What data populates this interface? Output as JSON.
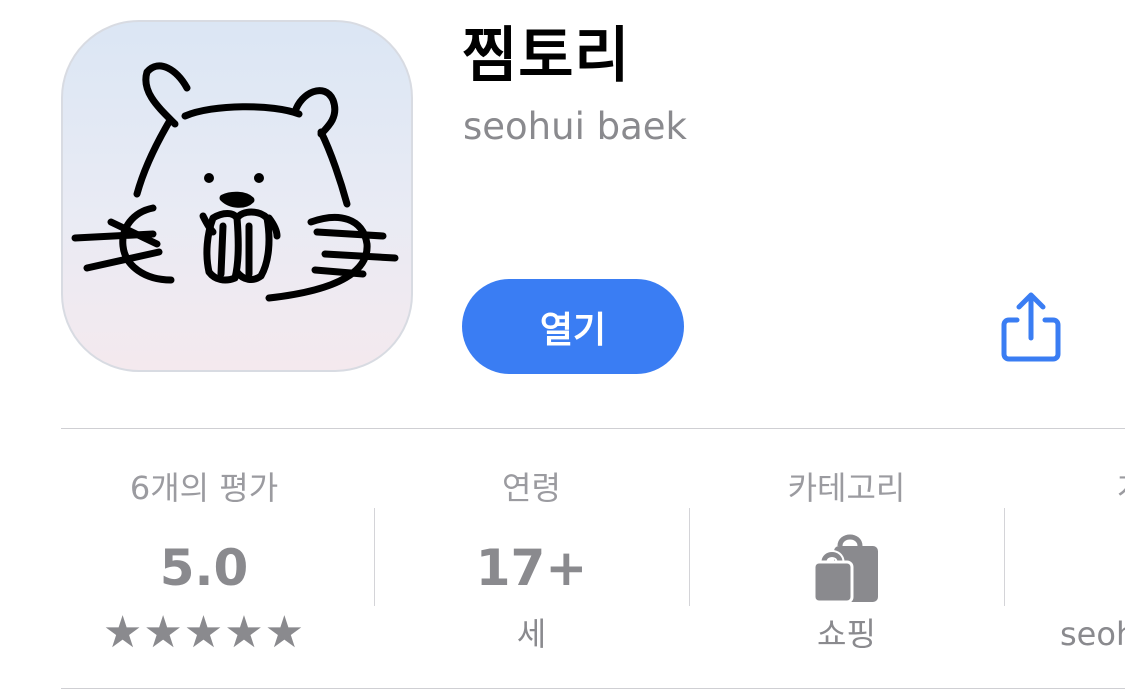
{
  "app": {
    "title": "찜토리",
    "developer": "seohui baek",
    "open_label": "열기",
    "icon": "beaver-face-app-icon",
    "accent_color": "#3a7df3"
  },
  "info": {
    "ratings": {
      "label": "6개의 평가",
      "value": "5.0",
      "stars": "★★★★★",
      "rating": 5
    },
    "age": {
      "label": "연령",
      "value": "17+",
      "sub": "세"
    },
    "category": {
      "label": "카테고리",
      "icon": "shopping-bag-icon",
      "sub": "쇼핑"
    },
    "developer": {
      "label": "개",
      "sub": "seoh"
    }
  },
  "icons": {
    "share": "share-icon"
  }
}
